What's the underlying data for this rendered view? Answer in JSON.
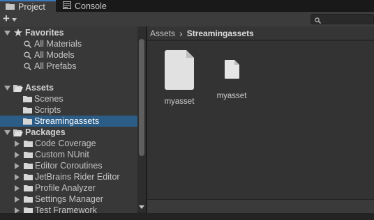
{
  "tabs": [
    {
      "label": "Project",
      "icon": "folder-icon"
    },
    {
      "label": "Console",
      "icon": "console-icon"
    }
  ],
  "toolbar": {
    "add_label": "+",
    "search_placeholder": ""
  },
  "tree": [
    {
      "label": "Favorites",
      "type": "header",
      "icon": "star-icon"
    },
    {
      "label": "All Materials",
      "type": "search"
    },
    {
      "label": "All Models",
      "type": "search"
    },
    {
      "label": "All Prefabs",
      "type": "search"
    },
    {
      "label": "Assets",
      "type": "header",
      "icon": "folder-open-icon"
    },
    {
      "label": "Scenes",
      "type": "folder"
    },
    {
      "label": "Scripts",
      "type": "folder"
    },
    {
      "label": "Streamingassets",
      "type": "folder",
      "selected": true
    },
    {
      "label": "Packages",
      "type": "header",
      "icon": "folder-open-icon"
    },
    {
      "label": "Code Coverage",
      "type": "package"
    },
    {
      "label": "Custom NUnit",
      "type": "package"
    },
    {
      "label": "Editor Coroutines",
      "type": "package"
    },
    {
      "label": "JetBrains Rider Editor",
      "type": "package"
    },
    {
      "label": "Profile Analyzer",
      "type": "package"
    },
    {
      "label": "Settings Manager",
      "type": "package"
    },
    {
      "label": "Test Framework",
      "type": "package"
    }
  ],
  "breadcrumb": {
    "root": "Assets",
    "separator": "›",
    "current": "Streamingassets"
  },
  "assets": [
    {
      "name": "myasset",
      "icon": "file-large-icon"
    },
    {
      "name": "myasset",
      "icon": "file-icon"
    }
  ],
  "colors": {
    "selection": "#2c5d87",
    "panel": "#383838",
    "accent": "#3a79bb"
  }
}
